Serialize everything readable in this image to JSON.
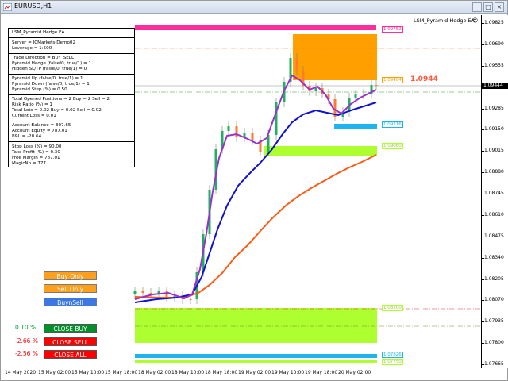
{
  "window": {
    "title": "EURUSD,H1",
    "min": "_",
    "max": "□",
    "close": "×"
  },
  "ea": {
    "name": "LSM_Pyramid Hedge EA",
    "face": "☺"
  },
  "colors": {
    "pink": "#ff2c9c",
    "orange": "#ffa000",
    "lime": "#adff2f",
    "cyan": "#1eb4f0",
    "buy": "#00b050",
    "sell": "#ff0000",
    "ma_fast": "#9b30d0",
    "ma_mid": "#1010d0",
    "ma_slow": "#ff5a14"
  },
  "info": {
    "ea_name": "LSM_Pyramid Hedge EA",
    "server": "Server = ICMarkets-Demo02",
    "leverage": "Leverage = 1:500",
    "direction": "Trade Direction = BUY_SELL",
    "hedge": "Pyramid Hedge (false/0, true/1) = 1",
    "hidden": "Hidden SL/TP (false/0, true/1) = 0",
    "up": "Pyramid Up (false/0, true/1) = 1",
    "down": "Pyramid Down (false/0, true/1) = 1",
    "step": "Pyramid Step (%) = 0.50",
    "positions": "Total Opened Positions = 2   Buy = 2   Sell = 2",
    "risk": "Risk Ratio (%) = 1",
    "lots": "Total Lots = 0.02   Buy = 0.02   Sell = 0.02",
    "loss": "Current Loss = 0.01",
    "balance": "Account Balance = 807.65",
    "equity": "Account Equity = 787.01",
    "pnl": "P&L = -20.64",
    "sl": "Stop Loss (%) = 90.00",
    "tp": "Take Profit (%) = 0.30",
    "margin": "Free Margin = 787.01",
    "magic": "MagicNo = 777"
  },
  "buttons": {
    "buy_only": "Buy Only",
    "sell_only": "Sell Only",
    "buy_n_sell": "BuynSell",
    "close_buy": "CLOSE BUY",
    "close_sell": "CLOSE SELL",
    "close_all": "CLOSE ALL"
  },
  "pnl_pct": {
    "buy": "0.10 %",
    "sell": "-2.66 %",
    "all": "-2.56 %"
  },
  "price_tags": {
    "t1": "1.09752",
    "t2": "1.09484",
    "t3": "1.09216",
    "t4": "1.09080",
    "t5": "1.08200",
    "t6": "1.07826",
    "t7": "1.07750"
  },
  "current_price": "1.0944",
  "current_price_axis": "1.09444",
  "price_axis": [
    {
      "label": "1.09825",
      "price": 1.09825
    },
    {
      "label": "1.09690",
      "price": 1.0969
    },
    {
      "label": "1.09555",
      "price": 1.09555
    },
    {
      "label": "1.09420",
      "price": 1.0942
    },
    {
      "label": "1.09285",
      "price": 1.09285
    },
    {
      "label": "1.09150",
      "price": 1.0915
    },
    {
      "label": "1.09015",
      "price": 1.09015
    },
    {
      "label": "1.08880",
      "price": 1.0888
    },
    {
      "label": "1.08745",
      "price": 1.08745
    },
    {
      "label": "1.08610",
      "price": 1.0861
    },
    {
      "label": "1.08475",
      "price": 1.08475
    },
    {
      "label": "1.08340",
      "price": 1.0834
    },
    {
      "label": "1.08205",
      "price": 1.08205
    },
    {
      "label": "1.08070",
      "price": 1.0807
    },
    {
      "label": "1.07935",
      "price": 1.07935
    },
    {
      "label": "1.07800",
      "price": 1.078
    },
    {
      "label": "1.07665",
      "price": 1.07665
    }
  ],
  "time_axis": [
    "14 May 2020",
    "15 May 02:00",
    "15 May 10:00",
    "15 May 18:00",
    "18 May 02:00",
    "18 May 10:00",
    "18 May 18:00",
    "19 May 02:00",
    "19 May 10:00",
    "19 May 18:00",
    "20 May 02:00"
  ]
}
